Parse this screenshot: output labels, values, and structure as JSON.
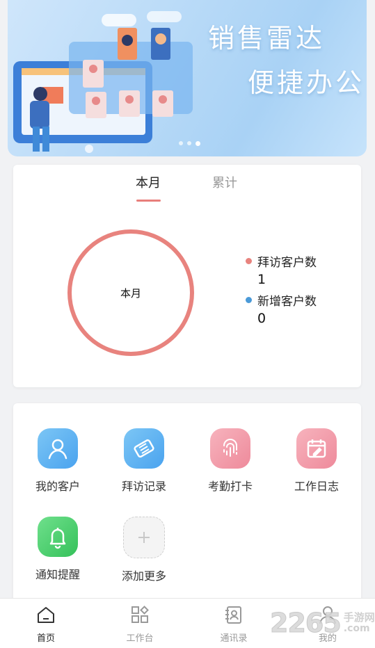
{
  "banner": {
    "slogan_line1": "销售雷达",
    "slogan_line2": "便捷办公",
    "carousel_dots": 3,
    "active_dot": 3
  },
  "stats": {
    "tabs": [
      {
        "label": "本月",
        "active": true
      },
      {
        "label": "累计",
        "active": false
      }
    ],
    "ring_center_label": "本月",
    "legend": [
      {
        "label": "拜访客户数",
        "value": "1",
        "color": "#e8837e"
      },
      {
        "label": "新增客户数",
        "value": "0",
        "color": "#4a9ad8"
      }
    ]
  },
  "apps": [
    {
      "label": "我的客户",
      "icon": "customer-icon",
      "color": "#5fb6f2"
    },
    {
      "label": "拜访记录",
      "icon": "handshake-icon",
      "color": "#5fb6f2"
    },
    {
      "label": "考勤打卡",
      "icon": "fingerprint-icon",
      "color": "#f29aa8"
    },
    {
      "label": "工作日志",
      "icon": "calendar-icon",
      "color": "#f29aa8"
    },
    {
      "label": "通知提醒",
      "icon": "bell-icon",
      "color": "#46d06a"
    },
    {
      "label": "添加更多",
      "icon": "plus-icon",
      "color": "#f1f1f1"
    }
  ],
  "bottom_nav": [
    {
      "label": "首页",
      "icon": "home-icon",
      "active": true
    },
    {
      "label": "工作台",
      "icon": "workbench-icon",
      "active": false
    },
    {
      "label": "通讯录",
      "icon": "contacts-icon",
      "active": false
    },
    {
      "label": "我的",
      "icon": "profile-icon",
      "active": false
    }
  ],
  "watermark": {
    "number": "2265",
    "cn": "手游网",
    "en": ".com"
  }
}
